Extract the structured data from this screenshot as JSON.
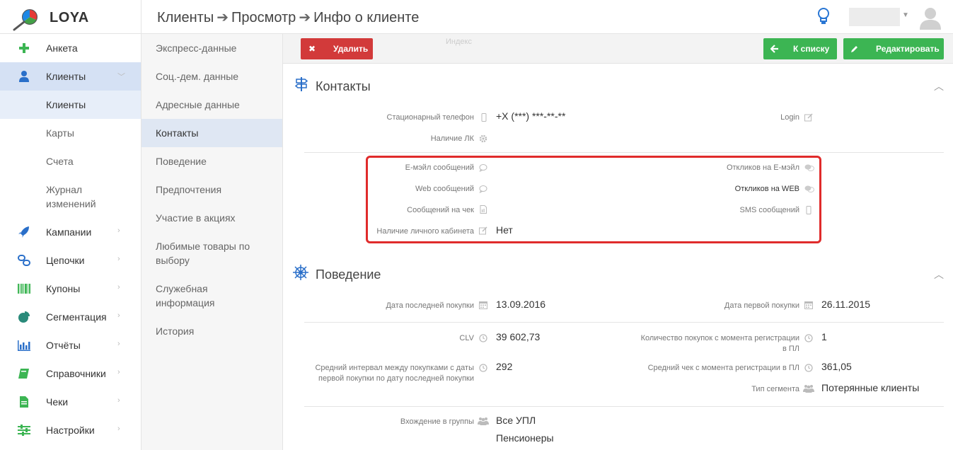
{
  "app": {
    "logo_text": "LOYA"
  },
  "breadcrumb": {
    "item1": "Клиенты",
    "item2": "Просмотр",
    "item3": "Инфо о клиенте",
    "sep": "➔"
  },
  "sidebar": {
    "items": [
      {
        "label": "Анкета",
        "icon": "plus-icon"
      },
      {
        "label": "Клиенты",
        "icon": "user-icon"
      },
      {
        "label": "Кампании",
        "icon": "rocket-icon"
      },
      {
        "label": "Цепочки",
        "icon": "chain-icon"
      },
      {
        "label": "Купоны",
        "icon": "barcode-icon"
      },
      {
        "label": "Сегментация",
        "icon": "pie-icon"
      },
      {
        "label": "Отчёты",
        "icon": "bar-chart-icon"
      },
      {
        "label": "Справочники",
        "icon": "book-icon"
      },
      {
        "label": "Чеки",
        "icon": "document-icon"
      },
      {
        "label": "Настройки",
        "icon": "sliders-icon"
      }
    ],
    "sub": [
      {
        "label": "Клиенты"
      },
      {
        "label": "Карты"
      },
      {
        "label": "Счета"
      },
      {
        "line1": "Журнал",
        "line2": "изменений"
      }
    ]
  },
  "subnav": {
    "items": [
      {
        "label": "Экспресс-данные"
      },
      {
        "label": "Соц.-дем. данные"
      },
      {
        "label": "Адресные данные"
      },
      {
        "label": "Контакты"
      },
      {
        "label": "Поведение"
      },
      {
        "label": "Предпочтения"
      },
      {
        "label": "Участие в акциях"
      },
      {
        "line1": "Любимые товары по",
        "line2": "выбору"
      },
      {
        "line1": "Служебная",
        "line2": "информация"
      },
      {
        "label": "История"
      }
    ]
  },
  "actions": {
    "delete": "Удалить",
    "to_list": "К списку",
    "edit": "Редактировать",
    "faint_label": "Индекс"
  },
  "contacts": {
    "title": "Контакты",
    "phone_label": "Стационарный телефон",
    "phone_value": "+X (***) ***-**-**",
    "login_label": "Login",
    "lk_label": "Наличие ЛК",
    "email_msgs_label": "Е-мэйл сообщений",
    "email_resp_label": "Откликов на Е-мэйл",
    "web_msgs_label": "Web сообщений",
    "web_resp_label": "Откликов на WEB",
    "check_msgs_label": "Сообщений на чек",
    "sms_label": "SMS сообщений",
    "cabinet_label": "Наличие личного кабинета",
    "cabinet_value": "Нет"
  },
  "behavior": {
    "title": "Поведение",
    "last_purchase_label": "Дата последней покупки",
    "last_purchase_value": "13.09.2016",
    "first_purchase_label": "Дата первой покупки",
    "first_purchase_value": "26.11.2015",
    "clv_label": "CLV",
    "clv_value": "39 602,73",
    "count_label_1": "Количество покупок с момента регистрации",
    "count_label_2": "в ПЛ",
    "count_value": "1",
    "interval_label_1": "Средний интервал между покупками с даты",
    "interval_label_2": "первой покупки по дату последней покупки",
    "interval_value": "292",
    "avg_check_label": "Средний чек с момента регистрации в ПЛ",
    "avg_check_value": "361,05",
    "segment_type_label": "Тип сегмента",
    "segment_type_value": "Потерянные клиенты",
    "groups_label": "Вхождение в группы",
    "groups": [
      "Все УПЛ",
      "Пенсионеры"
    ]
  },
  "colors": {
    "accent_green": "#3cb553",
    "danger_red": "#d23a3a",
    "highlight_border": "#e02b2b",
    "active_nav": "#d5e1f4"
  }
}
